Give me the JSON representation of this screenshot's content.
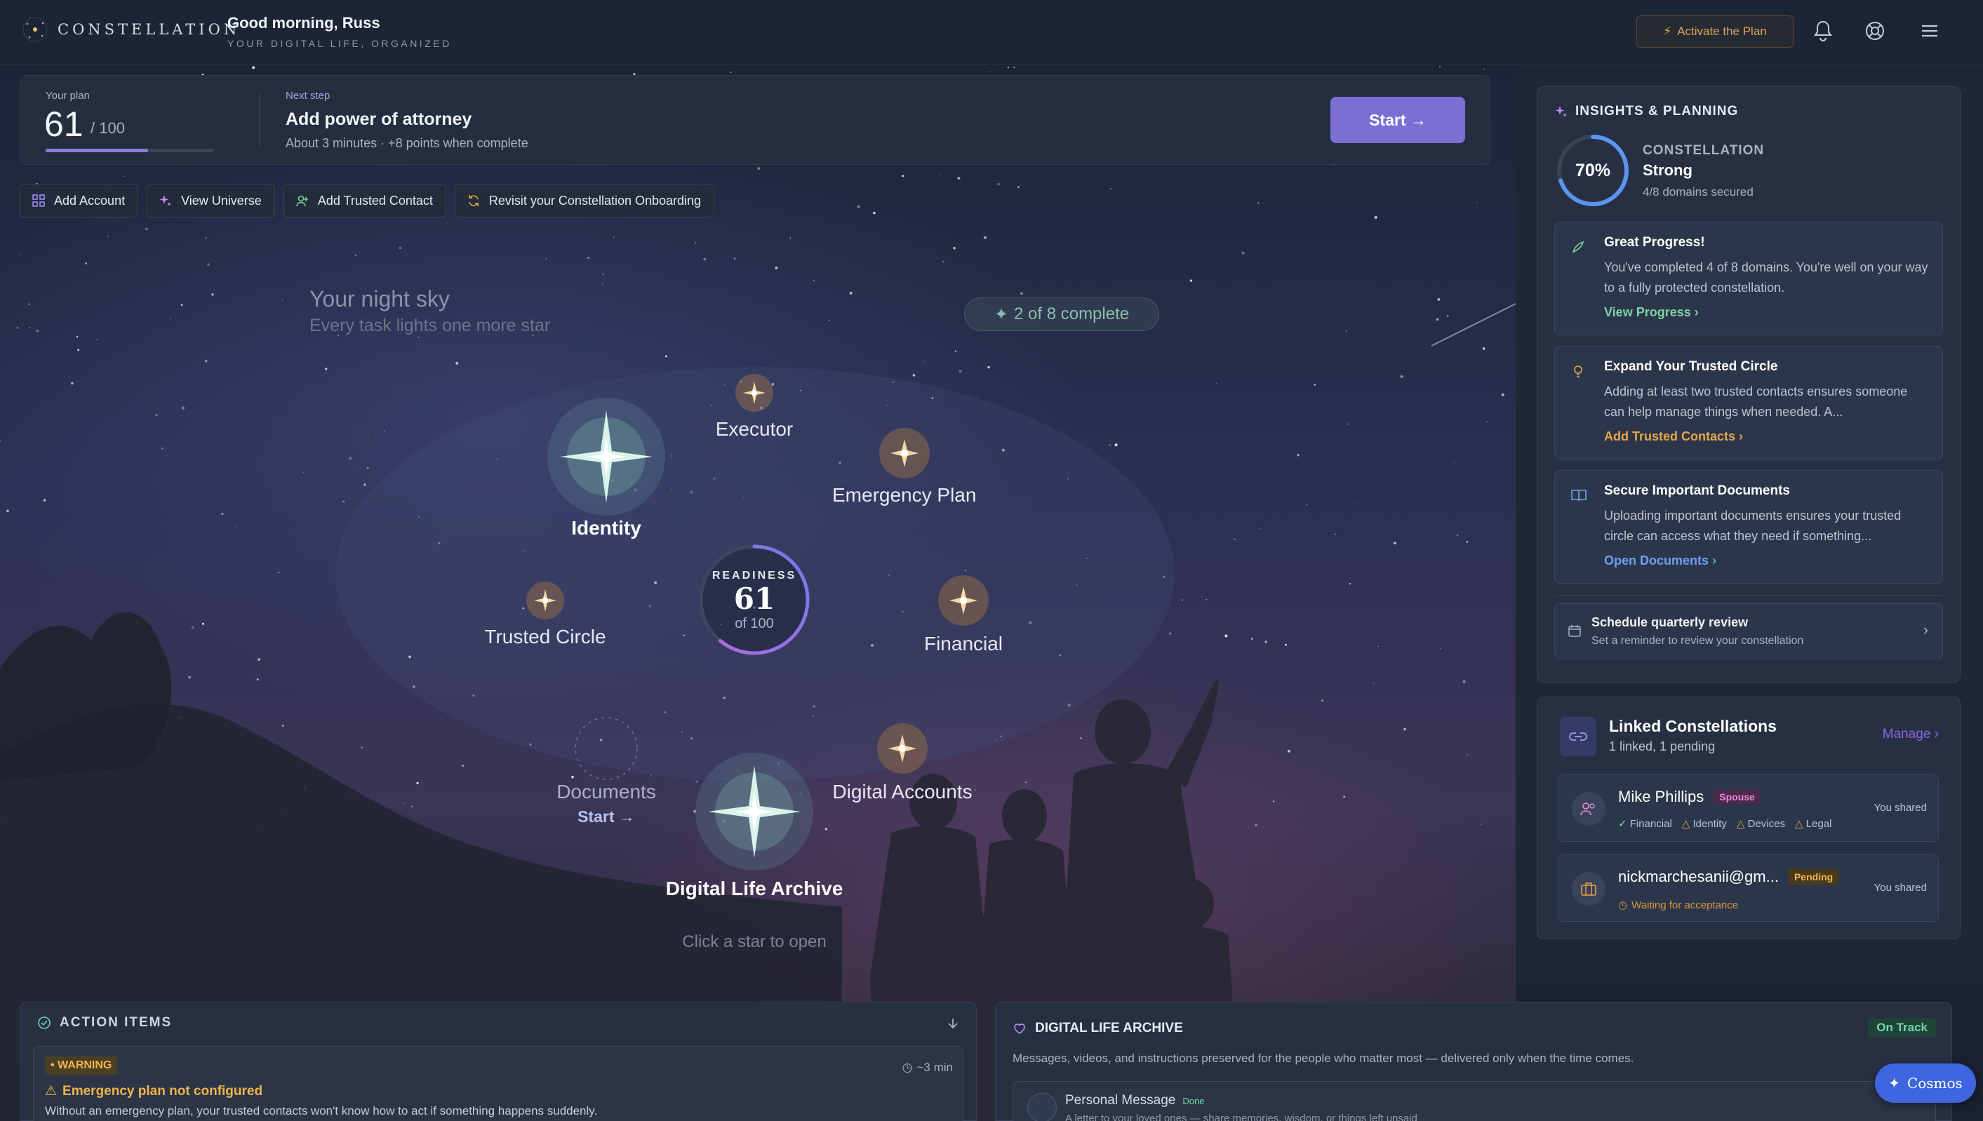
{
  "header": {
    "logo_text": "CONSTELLATION",
    "greeting": "Good morning, Russ",
    "tagline": "YOUR DIGITAL LIFE, ORGANIZED",
    "activate_label": "Activate the Plan",
    "icons": [
      "bell-icon",
      "lifebuoy-icon",
      "menu-icon"
    ]
  },
  "plan": {
    "label": "Your plan",
    "score": "61",
    "out_of": "/ 100",
    "progress": 0.61,
    "next_label": "Next step",
    "next_title": "Add power of attorney",
    "next_sub": "About 3 minutes · +8 points when complete",
    "start_label": "Start →"
  },
  "quick_actions": [
    {
      "label": "Add Account",
      "icon": "grid-icon"
    },
    {
      "label": "View Universe",
      "icon": "sparkles-icon"
    },
    {
      "label": "Add Trusted Contact",
      "icon": "user-plus-icon"
    },
    {
      "label": "Revisit your Constellation Onboarding",
      "icon": "refresh-icon"
    }
  ],
  "sky": {
    "title": "Your night sky",
    "subtitle": "Every task lights one more star",
    "complete_pill": "2 of 8 complete",
    "click_hint": "Click a star to open",
    "readiness_caption": "READINESS",
    "readiness_value": "61",
    "readiness_of": "of 100",
    "readiness_progress": 0.61,
    "stars": {
      "identity": "Identity",
      "executor": "Executor",
      "emergency": "Emergency Plan",
      "trusted": "Trusted Circle",
      "financial": "Financial",
      "documents": "Documents",
      "documents_start": "Start →",
      "digital_accounts": "Digital Accounts",
      "archive": "Digital Life Archive"
    }
  },
  "action_items": {
    "title": "ACTION ITEMS",
    "badge": "• WARNING",
    "time": "~3 min",
    "item_title": "Emergency plan not configured",
    "item_desc": "Without an emergency plan, your trusted contacts won't know how to act if something happens suddenly."
  },
  "archive": {
    "title": "DIGITAL LIFE ARCHIVE",
    "status": "On Track",
    "desc": "Messages, videos, and instructions preserved for the people who matter most — delivered only when the time comes.",
    "item_title": "Personal Message",
    "item_status": "Done",
    "item_sub": "A letter to your loved ones — share memories, wisdom, or things left unsaid"
  },
  "cosmos_label": "Cosmos",
  "insights": {
    "title": "INSIGHTS & PLANNING",
    "percent": "70%",
    "percent_value": 0.7,
    "constellation_label": "CONSTELLATION",
    "strength": "Strong",
    "domains": "4/8 domains secured",
    "cards": [
      {
        "title": "Great Progress!",
        "desc": "You've completed 4 of 8 domains. You're well on your way to a fully protected constellation.",
        "link": "View Progress",
        "color": "#7ed3a8",
        "icon": "rocket-icon"
      },
      {
        "title": "Expand Your Trusted Circle",
        "desc": "Adding at least two trusted contacts ensures someone can help manage things when needed. A...",
        "link": "Add Trusted Contacts",
        "color": "#e8a54a",
        "icon": "lightbulb-icon"
      },
      {
        "title": "Secure Important Documents",
        "desc": "Uploading important documents ensures your trusted circle can access what they need if something...",
        "link": "Open Documents",
        "color": "#6f9ff2",
        "icon": "book-icon"
      }
    ],
    "schedule_title": "Schedule quarterly review",
    "schedule_sub": "Set a reminder to review your constellation"
  },
  "linked": {
    "title": "Linked Constellations",
    "sub": "1 linked, 1 pending",
    "manage": "Manage",
    "people": [
      {
        "name": "Mike Phillips",
        "tag": "Spouse",
        "shared": "You shared",
        "domains": [
          "Financial",
          "Identity",
          "Devices",
          "Legal"
        ]
      },
      {
        "name": "nickmarchesanii@gm...",
        "tag": "Pending",
        "shared": "You shared",
        "waiting": "Waiting for acceptance"
      }
    ]
  }
}
